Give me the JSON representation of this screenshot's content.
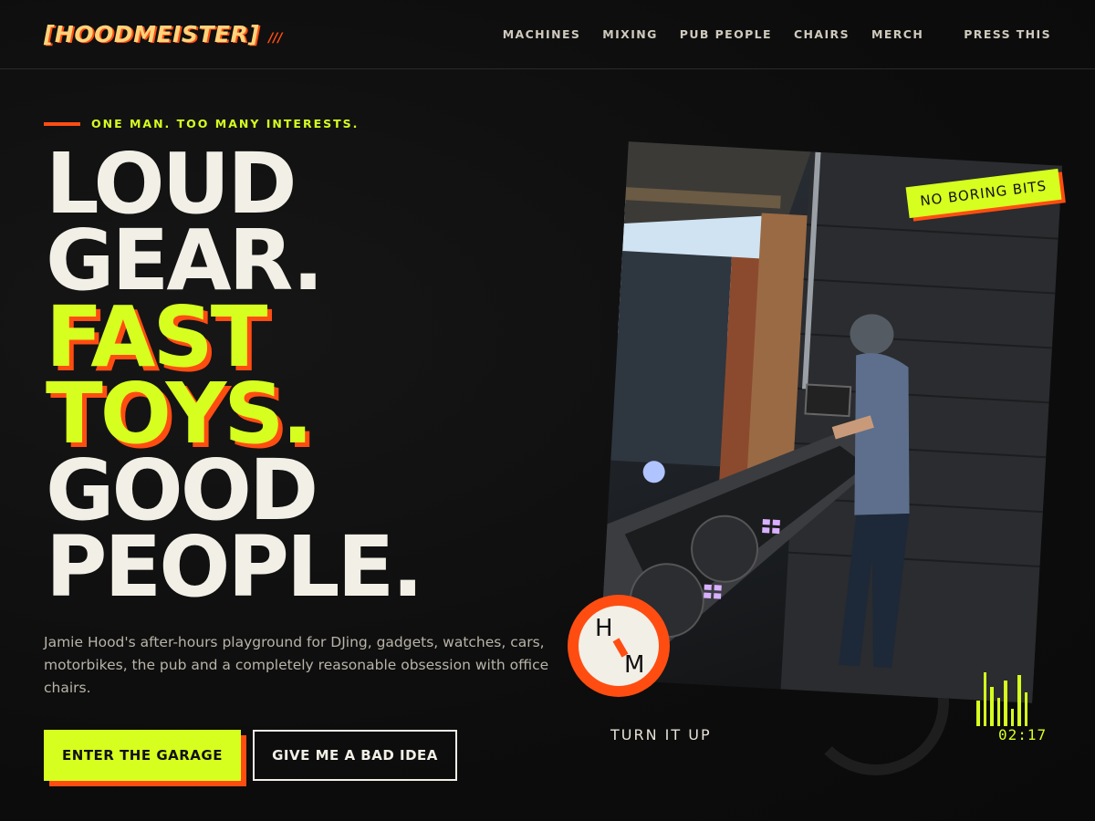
{
  "header": {
    "logo": "[HOODMEISTER]",
    "logo_accent": "///",
    "nav": [
      "MACHINES",
      "MIXING",
      "PUB PEOPLE",
      "CHAIRS",
      "MERCH"
    ],
    "press": "PRESS THIS"
  },
  "hero": {
    "kicker": "ONE MAN. TOO MANY INTERESTS.",
    "headline": [
      "LOUD",
      "GEAR.",
      "FAST",
      "TOYS.",
      "GOOD",
      "PEOPLE."
    ],
    "blurb": "Jamie Hood's after-hours playground for DJing, gadgets, watches, cars, motorbikes, the pub and a completely reasonable obsession with office chairs.",
    "primary_cta": "ENTER THE GARAGE",
    "secondary_cta": "GIVE ME A BAD IDEA"
  },
  "photo": {
    "badge": "NO BORING BITS",
    "monogram_top": "H",
    "monogram_bottom": "M"
  },
  "player": {
    "label": "TURN IT UP",
    "time": "02:17",
    "levels": [
      0.45,
      0.95,
      0.7,
      0.5,
      0.8,
      0.3,
      0.9,
      0.6
    ]
  },
  "colors": {
    "accent_lime": "#d6ff1f",
    "accent_orange": "#ff4d12",
    "background": "#0d0d0d",
    "text": "#f2efe6"
  }
}
